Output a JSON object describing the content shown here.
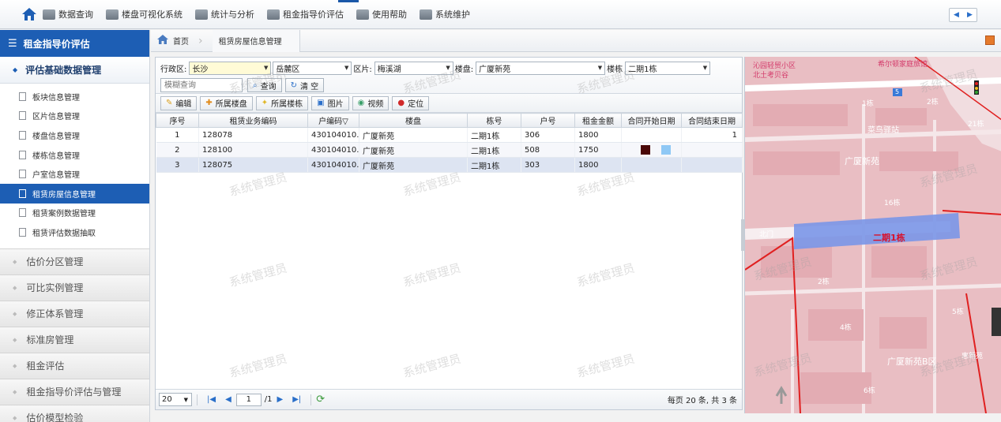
{
  "topnav": {
    "items": [
      "数据查询",
      "楼盘可视化系统",
      "统计与分析",
      "租金指导价评估",
      "使用帮助",
      "系统维护"
    ],
    "pager_prev": "◀",
    "pager_next": "▶"
  },
  "sidebar": {
    "title": "租金指导价评估",
    "open_group": "评估基础数据管理",
    "items": [
      "板块信息管理",
      "区片信息管理",
      "楼盘信息管理",
      "楼栋信息管理",
      "户室信息管理",
      "租赁房屋信息管理",
      "租赁案例数据管理",
      "租赁评估数据抽取"
    ],
    "active_item": "租赁房屋信息管理",
    "groups": [
      "估价分区管理",
      "可比实例管理",
      "修正体系管理",
      "标准房管理",
      "租金评估",
      "租金指导价评估与管理",
      "估价模型检验"
    ]
  },
  "breadcrumb": {
    "home": "首页",
    "current": "租赁房屋信息管理"
  },
  "filters": {
    "district_label": "行政区:",
    "city_value": "长沙",
    "district_value": "岳麓区",
    "area_label": "区片:",
    "area_value": "梅溪湖",
    "estate_label": "楼盘:",
    "estate_value": "广厦新苑",
    "building_label": "楼栋",
    "building_value": "二期1栋",
    "keyword_placeholder": "模糊查询",
    "query_button": "查询",
    "clear_button": "清 空"
  },
  "toolbar": [
    "编辑",
    "所属楼盘",
    "所属楼栋",
    "图片",
    "视频",
    "定位"
  ],
  "table": {
    "columns": [
      "序号",
      "租赁业务编码",
      "户编码▽",
      "楼盘",
      "栋号",
      "户号",
      "租金金额",
      "合同开始日期",
      "合同结束日期"
    ],
    "rows": [
      [
        "1",
        "128078",
        "430104010...",
        "广厦新苑",
        "二期1栋",
        "306",
        "1800",
        "",
        "1"
      ],
      [
        "2",
        "128100",
        "430104010...",
        "广厦新苑",
        "二期1栋",
        "508",
        "1750",
        "",
        ""
      ],
      [
        "3",
        "128075",
        "430104010...",
        "广厦新苑",
        "二期1栋",
        "303",
        "1800",
        "",
        ""
      ]
    ]
  },
  "pager": {
    "page_size": "20",
    "current_page": "1",
    "total_pages": "/1",
    "info": "每页 20 条, 共 3 条"
  },
  "watermark": "系统管理员",
  "map": {
    "labels": [
      "沁园轻贸小区",
      "北土考贝谷",
      "希尔顿家庭旅馆",
      "1栋",
      "2栋",
      "菜鸟驿站",
      "21栋",
      "广厦新苑",
      "16栋",
      "二期1栋",
      "北门",
      "2栋",
      "5栋",
      "4栋",
      "广厦新苑B区",
      "惠新苑",
      "6栋"
    ],
    "road_badge": "5"
  },
  "colors": {
    "accent": "#1d5eb4",
    "map_fill": "#e8b8bd",
    "highlight_building": "#7a96e8",
    "highlight_text": "#d8102a"
  }
}
